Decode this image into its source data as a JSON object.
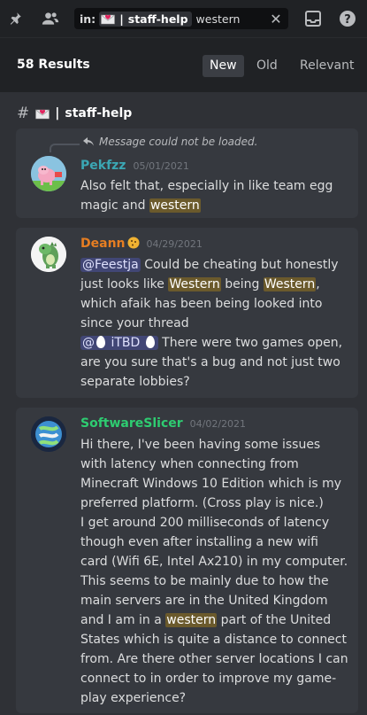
{
  "search": {
    "prefix": "in:",
    "channel": "staff-help",
    "query": "western"
  },
  "results": {
    "count_label": "58 Results",
    "sort_options": [
      "New",
      "Old",
      "Relevant"
    ],
    "active_sort": "New"
  },
  "channel": {
    "name": "staff-help"
  },
  "messages": [
    {
      "reply_note": "Message could not be loaded.",
      "author": "Pekfzz",
      "author_color": "#3ba7b4",
      "timestamp": "05/01/2021",
      "text_parts": [
        "Also felt that, especially in like team egg magic and ",
        "western",
        ""
      ]
    },
    {
      "author": "Deann",
      "author_color": "#e67e22",
      "timestamp": "04/29/2021",
      "mention1": "@Feestja",
      "text_a": " Could be cheating but honestly just looks like ",
      "hl1": "Western",
      "text_b": " being ",
      "hl2": "Western",
      "text_c": ", which afaik has been being looked into since your thread",
      "mention2_prefix": "@",
      "mention2_name": "iTBD",
      "text_d": " There were two games open, are you sure that's a bug and not just two separate lobbies?"
    },
    {
      "author": "SoftwareSlicer",
      "author_color": "#2ecc71",
      "timestamp": "04/02/2021",
      "text_a": "Hi there, I've been having some issues with latency when connecting from Minecraft Windows 10 Edition which is my preferred platform. (Cross play is nice.)",
      "text_b": "I get around 200 milliseconds of latency though even after installing a new wifi card (Wifi 6E, Intel Ax210) in my computer.",
      "text_c": "This seems to be mainly due to how the main servers are in the United Kingdom and I am in a ",
      "hl": "western",
      "text_d": " part of the United States which is quite a distance to connect from. Are there other server locations I can connect to in order to improve my game-play experience?"
    }
  ],
  "colors": {
    "highlight": "#6b5a2c",
    "background": "#2f3136",
    "card": "#36393f",
    "topbar": "#202225"
  }
}
